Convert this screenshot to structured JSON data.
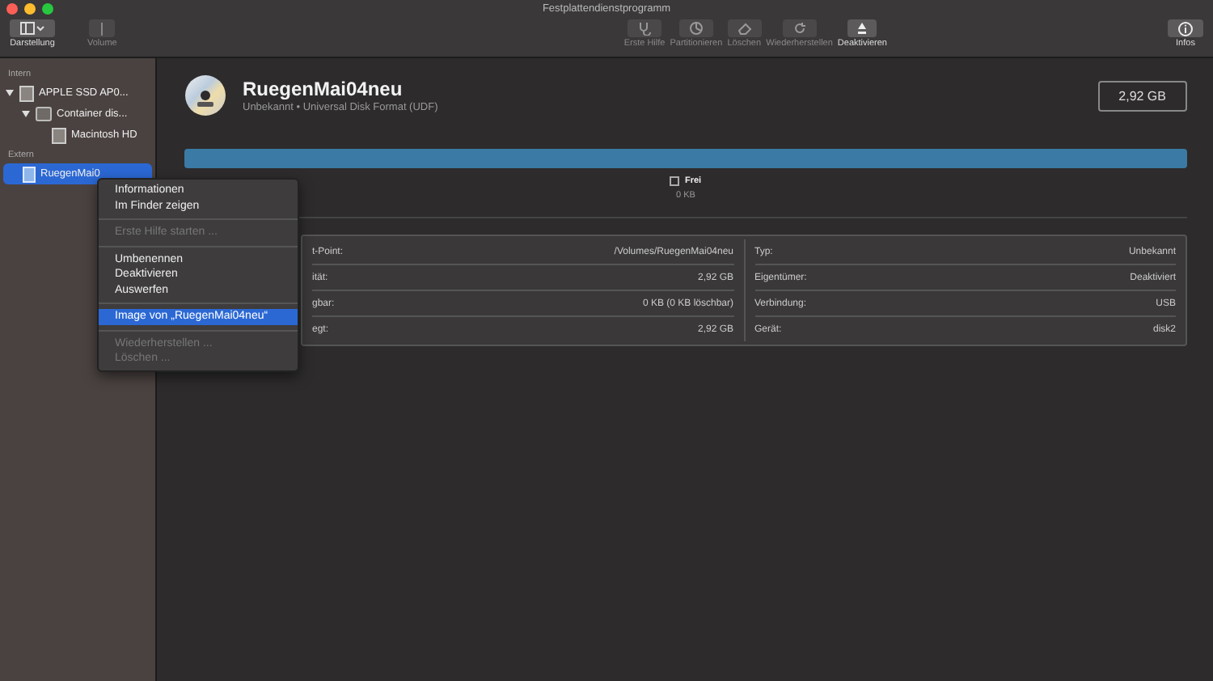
{
  "window": {
    "title": "Festplattendienstprogramm"
  },
  "toolbar": {
    "left": [
      {
        "label": "Darstellung",
        "kind": "view",
        "disabled": false
      },
      {
        "label": "Volume",
        "kind": "volume",
        "disabled": true
      }
    ],
    "center": [
      {
        "label": "Erste Hilfe",
        "kind": "firstaid",
        "disabled": true
      },
      {
        "label": "Partitionieren",
        "kind": "partition",
        "disabled": true
      },
      {
        "label": "Löschen",
        "kind": "erase",
        "disabled": true
      },
      {
        "label": "Wiederherstellen",
        "kind": "restore",
        "disabled": true
      },
      {
        "label": "Deaktivieren",
        "kind": "unmount",
        "disabled": false
      }
    ],
    "right": [
      {
        "label": "Infos",
        "kind": "info",
        "disabled": false
      }
    ]
  },
  "sidebar": {
    "sections": [
      {
        "title": "Intern",
        "items": [
          {
            "label": "APPLE SSD AP0...",
            "kind": "disk",
            "expanded": true,
            "selected": false,
            "children": [
              {
                "label": "Container dis...",
                "kind": "container",
                "expanded": true,
                "selected": false,
                "children": [
                  {
                    "label": "Macintosh HD",
                    "kind": "volume",
                    "selected": false
                  }
                ]
              }
            ]
          }
        ]
      },
      {
        "title": "Extern",
        "items": [
          {
            "label": "RuegenMai0",
            "kind": "disc",
            "selected": true
          }
        ]
      }
    ]
  },
  "volume": {
    "name": "RuegenMai04neu",
    "subtitle": "Unbekannt • Universal Disk Format (UDF)",
    "size": "2,92 GB"
  },
  "usage": {
    "level": 1,
    "legend": {
      "label": "Frei",
      "value": "0 KB"
    }
  },
  "info_table": {
    "left": [
      {
        "label": "t-Point:",
        "value": "/Volumes/RuegenMai04neu"
      },
      {
        "label": "ität:",
        "value": "2,92 GB"
      },
      {
        "label": "gbar:",
        "value": "0 KB (0 KB löschbar)"
      },
      {
        "label": "egt:",
        "value": "2,92 GB"
      }
    ],
    "right": [
      {
        "label": "Typ:",
        "value": "Unbekannt"
      },
      {
        "label": "Eigentümer:",
        "value": "Deaktiviert"
      },
      {
        "label": "Verbindung:",
        "value": "USB"
      },
      {
        "label": "Gerät:",
        "value": "disk2"
      }
    ]
  },
  "context_menu": {
    "groups": [
      [
        {
          "label": "Informationen",
          "disabled": false,
          "selected": false
        },
        {
          "label": "Im Finder zeigen",
          "disabled": false,
          "selected": false
        }
      ],
      [
        {
          "label": "Erste Hilfe starten ...",
          "disabled": true,
          "selected": false
        }
      ],
      [
        {
          "label": "Umbenennen",
          "disabled": false,
          "selected": false
        },
        {
          "label": "Deaktivieren",
          "disabled": false,
          "selected": false
        },
        {
          "label": "Auswerfen",
          "disabled": false,
          "selected": false
        }
      ],
      [
        {
          "label": "Image von „RuegenMai04neu“",
          "disabled": false,
          "selected": true
        }
      ],
      [
        {
          "label": "Wiederherstellen ...",
          "disabled": true,
          "selected": false
        },
        {
          "label": "Löschen ...",
          "disabled": true,
          "selected": false
        }
      ]
    ]
  }
}
